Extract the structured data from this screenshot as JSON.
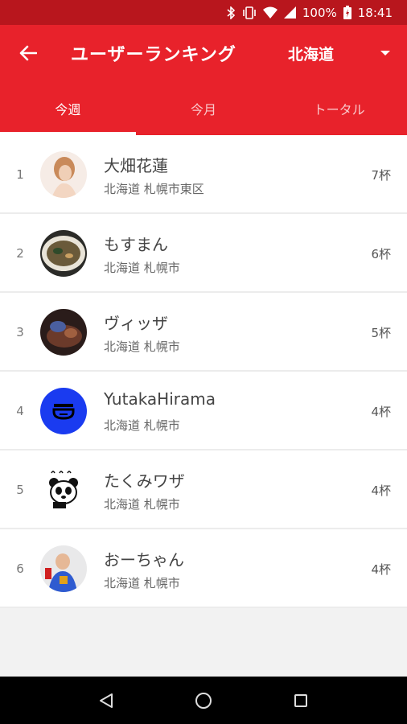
{
  "status_bar": {
    "battery": "100%",
    "time": "18:41"
  },
  "header": {
    "title": "ユーザーランキング",
    "region": "北海道"
  },
  "tabs": [
    {
      "label": "今週",
      "active": true
    },
    {
      "label": "今月",
      "active": false
    },
    {
      "label": "トータル",
      "active": false
    }
  ],
  "rankings": [
    {
      "rank": "1",
      "name": "大畑花蓮",
      "location": "北海道 札幌市東区",
      "count": "7杯",
      "avatar_icon": "photo-portrait-icon"
    },
    {
      "rank": "2",
      "name": "もすまん",
      "location": "北海道 札幌市",
      "count": "6杯",
      "avatar_icon": "ramen-bowl-photo-icon"
    },
    {
      "rank": "3",
      "name": "ヴィッザ",
      "location": "北海道 札幌市",
      "count": "5杯",
      "avatar_icon": "food-photo-icon"
    },
    {
      "rank": "4",
      "name": "YutakaHirama",
      "location": "北海道 札幌市",
      "count": "4杯",
      "avatar_icon": "bowl-logo-icon"
    },
    {
      "rank": "5",
      "name": "たくみワザ",
      "location": "北海道 札幌市",
      "count": "4杯",
      "avatar_icon": "panda-illustration-icon"
    },
    {
      "rank": "6",
      "name": "おーちゃん",
      "location": "北海道 札幌市",
      "count": "4杯",
      "avatar_icon": "person-photo-icon"
    }
  ],
  "colors": {
    "primary": "#e8222b",
    "status_bar": "#b8161d",
    "avatar_blue": "#1a3bf0"
  }
}
